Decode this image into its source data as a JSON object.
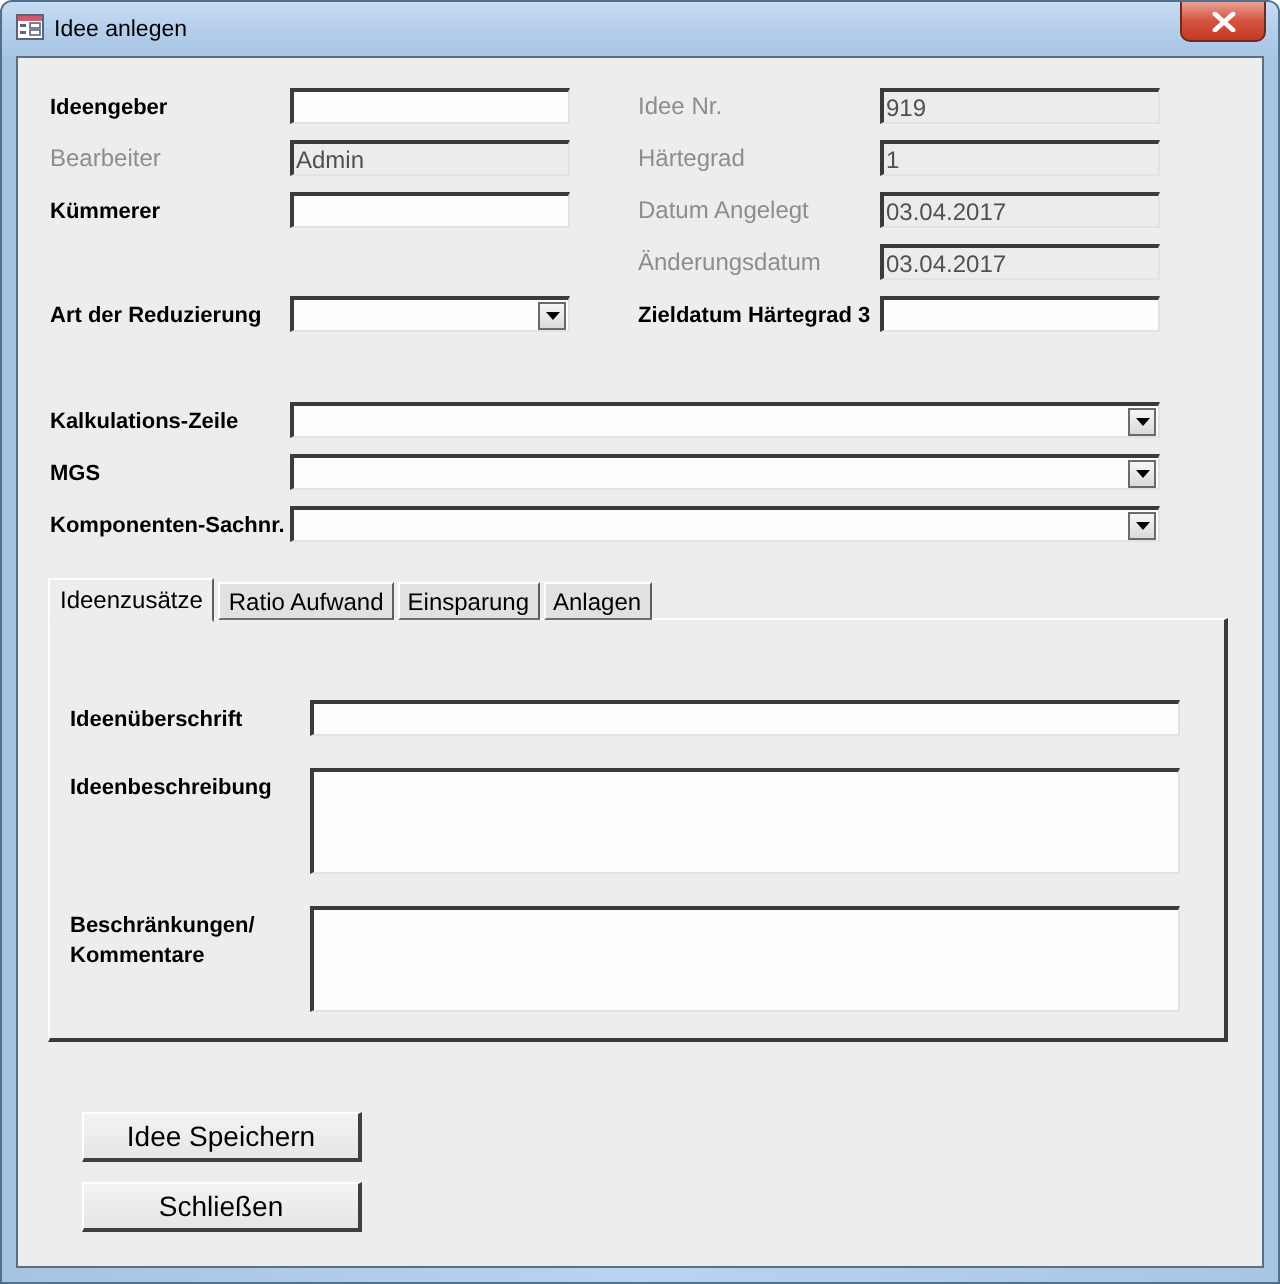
{
  "window": {
    "title": "Idee anlegen"
  },
  "header": {
    "left": [
      {
        "label": "Ideengeber",
        "kind": "text",
        "locked": false
      },
      {
        "label": "Bearbeiter",
        "kind": "text",
        "locked": true,
        "value": "Admin"
      },
      {
        "label": "Kümmerer",
        "kind": "text",
        "locked": false
      },
      {
        "label": "Art der Reduzierung",
        "kind": "combo",
        "locked": false
      }
    ],
    "right": [
      {
        "label": "Idee Nr.",
        "kind": "text",
        "locked": true,
        "value": "919"
      },
      {
        "label": "Härtegrad",
        "kind": "text",
        "locked": true,
        "value": "1"
      },
      {
        "label": "Datum Angelegt",
        "kind": "text",
        "locked": true,
        "value": "03.04.2017"
      },
      {
        "label": "Änderungsdatum",
        "kind": "text",
        "locked": true,
        "value": "03.04.2017"
      },
      {
        "label": "Zieldatum Härtegrad 3",
        "kind": "text",
        "locked": false
      }
    ]
  },
  "lookups": [
    {
      "label": "Kalkulations-Zeile",
      "kind": "combo",
      "locked": false
    },
    {
      "label": "MGS",
      "kind": "combo",
      "locked": false
    },
    {
      "label": "Komponenten-Sachnr.",
      "kind": "combo",
      "locked": false
    }
  ],
  "tabs": [
    {
      "label": "Ideenzusätze",
      "selected": true
    },
    {
      "label": "Ratio Aufwand",
      "selected": false
    },
    {
      "label": "Einsparung",
      "selected": false
    },
    {
      "label": "Anlagen",
      "selected": false
    }
  ],
  "tab_panel": {
    "fields": [
      {
        "label": "Ideenüberschrift",
        "kind": "line"
      },
      {
        "label": "Ideenbeschreibung",
        "kind": "memo"
      },
      {
        "label": "Beschränkungen/ Kommentare",
        "kind": "memo"
      }
    ]
  },
  "buttons": [
    {
      "label": "Idee Speichern"
    },
    {
      "label": "Schließen"
    }
  ]
}
